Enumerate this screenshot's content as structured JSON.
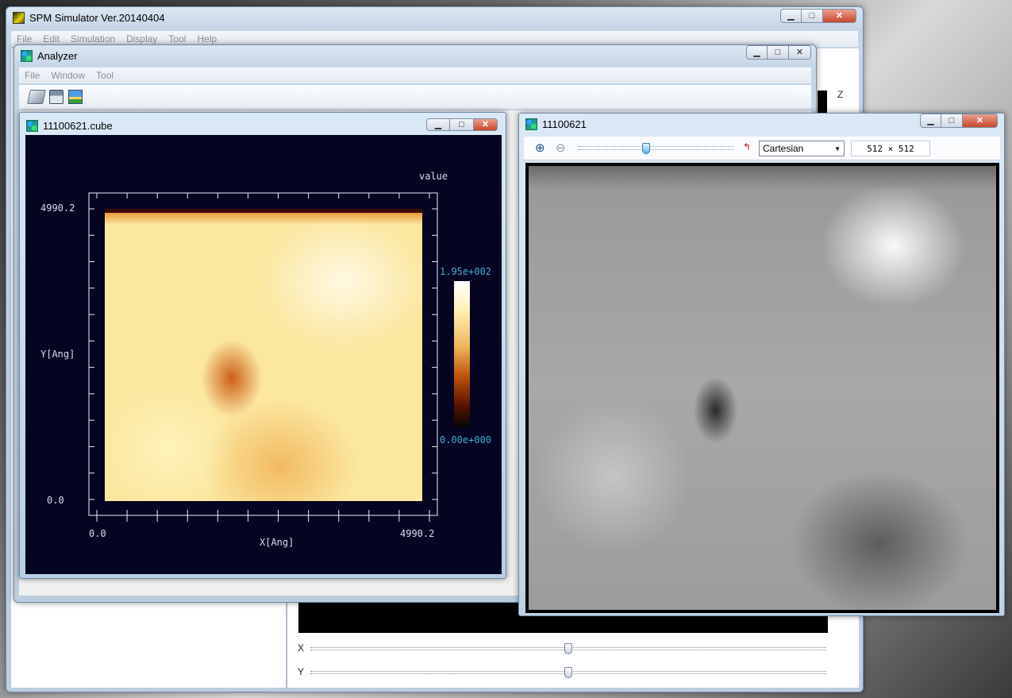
{
  "main_window": {
    "title": "SPM Simulator Ver.20140404",
    "menu": [
      "File",
      "Edit",
      "Simulation",
      "Display",
      "Tool",
      "Help"
    ],
    "z_label": "Z",
    "x_label": "X",
    "y_label": "Y",
    "x_slider": 0.5,
    "y_slider": 0.5
  },
  "analyzer": {
    "title": "Analyzer",
    "menu": [
      "File",
      "Window",
      "Tool"
    ],
    "toolbar": [
      "open-icon",
      "save-icon",
      "image-icon"
    ]
  },
  "cube_window": {
    "title": "11100621.cube",
    "legend_title": "value",
    "colorbar_max": "1.95e+002",
    "colorbar_min": "0.00e+000",
    "y_axis_label": "Y[Ang]",
    "x_axis_label": "X[Ang]",
    "y_tick_max": "4990.2",
    "y_tick_min": "0.0",
    "x_tick_min": "0.0",
    "x_tick_max": "4990.2"
  },
  "image_window": {
    "title": "11100621",
    "zoom_slider": 0.44,
    "projection": "Cartesian",
    "size": "512 × 512"
  },
  "colors": {
    "plot_bg": "#050522",
    "tick_text": "#d8dce8",
    "colorbar_label": "#46a8d0",
    "accent": "#c8462d"
  }
}
